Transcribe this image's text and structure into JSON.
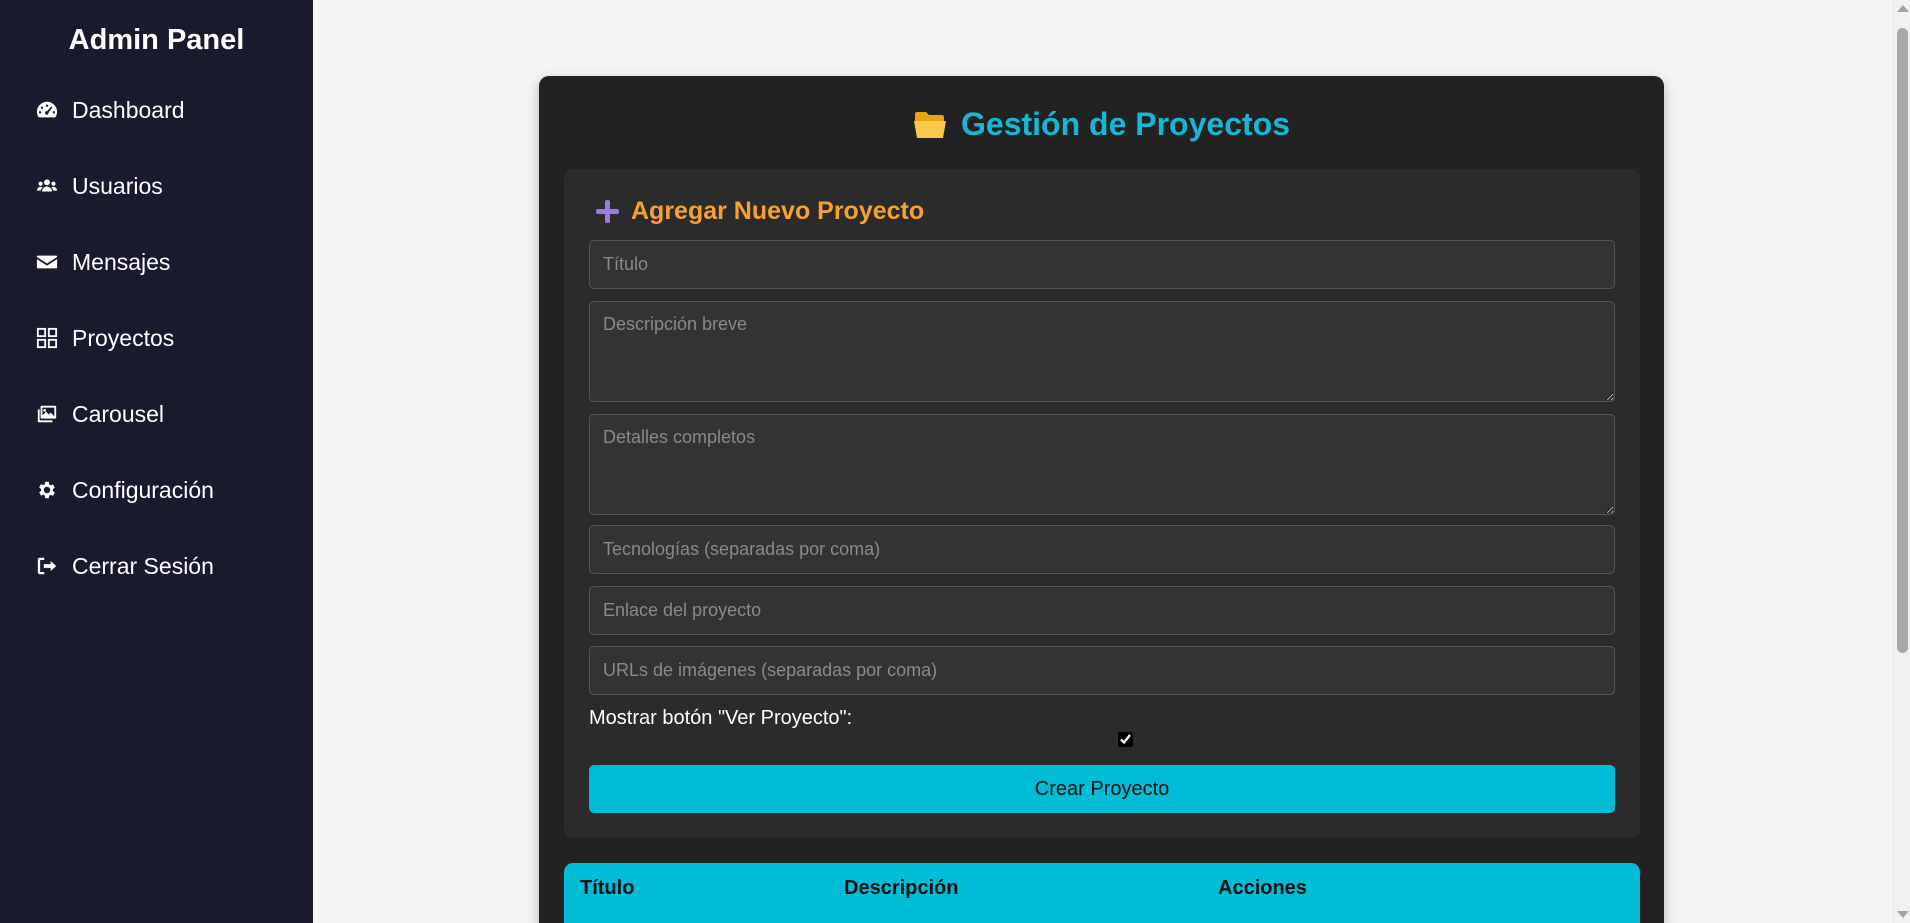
{
  "sidebar": {
    "title": "Admin Panel",
    "items": [
      {
        "label": "Dashboard",
        "icon": "dashboard-icon"
      },
      {
        "label": "Usuarios",
        "icon": "users-icon"
      },
      {
        "label": "Mensajes",
        "icon": "envelope-icon"
      },
      {
        "label": "Proyectos",
        "icon": "grid-icon"
      },
      {
        "label": "Carousel",
        "icon": "images-icon"
      },
      {
        "label": "Configuración",
        "icon": "gear-icon"
      },
      {
        "label": "Cerrar Sesión",
        "icon": "sign-out-icon"
      }
    ]
  },
  "main": {
    "title": "Gestión de Proyectos",
    "title_icon": "folder-icon",
    "form": {
      "heading": "Agregar Nuevo Proyecto",
      "heading_icon": "plus-icon",
      "fields": {
        "titulo_placeholder": "Título",
        "descripcion_placeholder": "Descripción breve",
        "detalles_placeholder": "Detalles completos",
        "tecnologias_placeholder": "Tecnologías (separadas por coma)",
        "enlace_placeholder": "Enlace del proyecto",
        "imagenes_placeholder": "URLs de imágenes (separadas por coma)"
      },
      "checkbox_label": "Mostrar botón \"Ver Proyecto\":",
      "checkbox_checked": true,
      "submit_label": "Crear Proyecto"
    },
    "table": {
      "headers": [
        "Título",
        "Descripción",
        "Acciones"
      ]
    }
  },
  "colors": {
    "sidebar_bg": "#1a1a2e",
    "accent": "#00bcd4",
    "title": "#19b6d3",
    "heading": "#f7a130",
    "card_bg": "#222222"
  }
}
